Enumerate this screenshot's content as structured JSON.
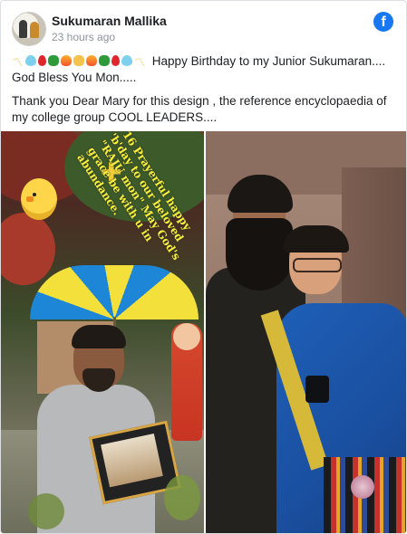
{
  "post": {
    "author": "Sukumaran Mallika",
    "timestamp": "23 hours ago",
    "platform_icon": "facebook-icon",
    "line1_text": "Happy Birthday to my Junior Sukumaran.... God Bless You Mon.....",
    "line2_text": "Thank you Dear Mary for this design , the reference encyclopaedia of my college group COOL LEADERS....",
    "emoji_sequence": [
      "hands-icon",
      "heart-icon",
      "drop-icon",
      "clover-icon",
      "fire-icon",
      "hands-icon",
      "fire-icon",
      "clover-icon",
      "drop-icon",
      "heart-icon",
      "hands-icon"
    ]
  },
  "images": {
    "left": {
      "overlay_text": "\"16 Prayerful happy 'b'day to our beloved \"RAJU mon\" May God's grace be with u in abundance.",
      "icons": [
        "chick-icon",
        "bow-icon",
        "umbrella-icon"
      ]
    },
    "right": {}
  }
}
